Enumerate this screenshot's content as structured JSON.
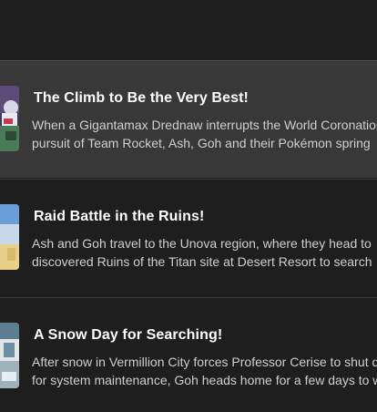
{
  "episodes": [
    {
      "title": "The Climb to Be the Very Best!",
      "description_lines": [
        "When a Gigantamax Drednaw interrupts the World Coronation",
        "pursuit of Team Rocket, Ash, Goh and their Pokémon spring"
      ],
      "highlighted": true,
      "thumbnail": "episode-thumbnail"
    },
    {
      "title": "Raid Battle in the Ruins!",
      "description_lines": [
        "Ash and Goh travel to the Unova region, where they head to",
        "discovered Ruins of the Titan site at Desert Resort to search"
      ],
      "highlighted": false,
      "thumbnail": "episode-thumbnail"
    },
    {
      "title": "A Snow Day for Searching!",
      "description_lines": [
        "After snow in Vermillion City forces Professor Cerise to shut do",
        "for system maintenance, Goh heads home for a few days to w"
      ],
      "highlighted": false,
      "thumbnail": "episode-thumbnail"
    }
  ],
  "colors": {
    "background": "#1e1e1e",
    "highlight": "#383838",
    "title": "#ffffff",
    "description": "#cfcfcf",
    "divider": "#3c3c3c"
  }
}
